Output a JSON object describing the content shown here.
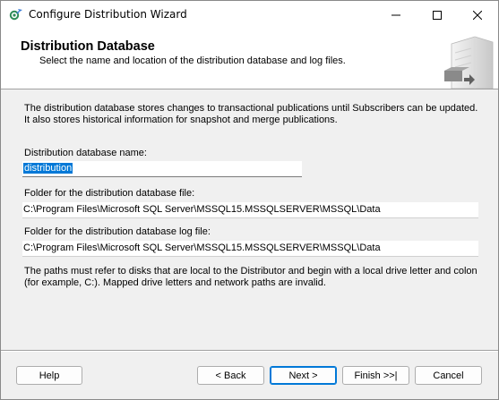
{
  "window": {
    "title": "Configure Distribution Wizard",
    "icon": "wizard-gear-icon"
  },
  "header": {
    "title": "Distribution Database",
    "subtitle": "Select the name and location of the distribution database and log files."
  },
  "content": {
    "description": "The distribution database stores changes to transactional publications until Subscribers can be updated. It also stores historical information for snapshot and merge publications.",
    "db_name_label": "Distribution database name:",
    "db_name_value": "distribution",
    "db_folder_label": "Folder for the distribution database file:",
    "db_folder_value": "C:\\Program Files\\Microsoft SQL Server\\MSSQL15.MSSQLSERVER\\MSSQL\\Data",
    "log_folder_label": "Folder for the distribution database log file:",
    "log_folder_value": "C:\\Program Files\\Microsoft SQL Server\\MSSQL15.MSSQLSERVER\\MSSQL\\Data",
    "note": "The paths must refer to disks that are local to the Distributor and begin with a local drive letter and colon (for example, C:). Mapped drive letters and network paths are invalid."
  },
  "buttons": {
    "help": "Help",
    "back": "< Back",
    "next": "Next >",
    "finish": "Finish >>|",
    "cancel": "Cancel"
  },
  "colors": {
    "selection": "#0078d7",
    "banner_bg": "#ffffff",
    "dialog_bg": "#f0f0f0"
  }
}
